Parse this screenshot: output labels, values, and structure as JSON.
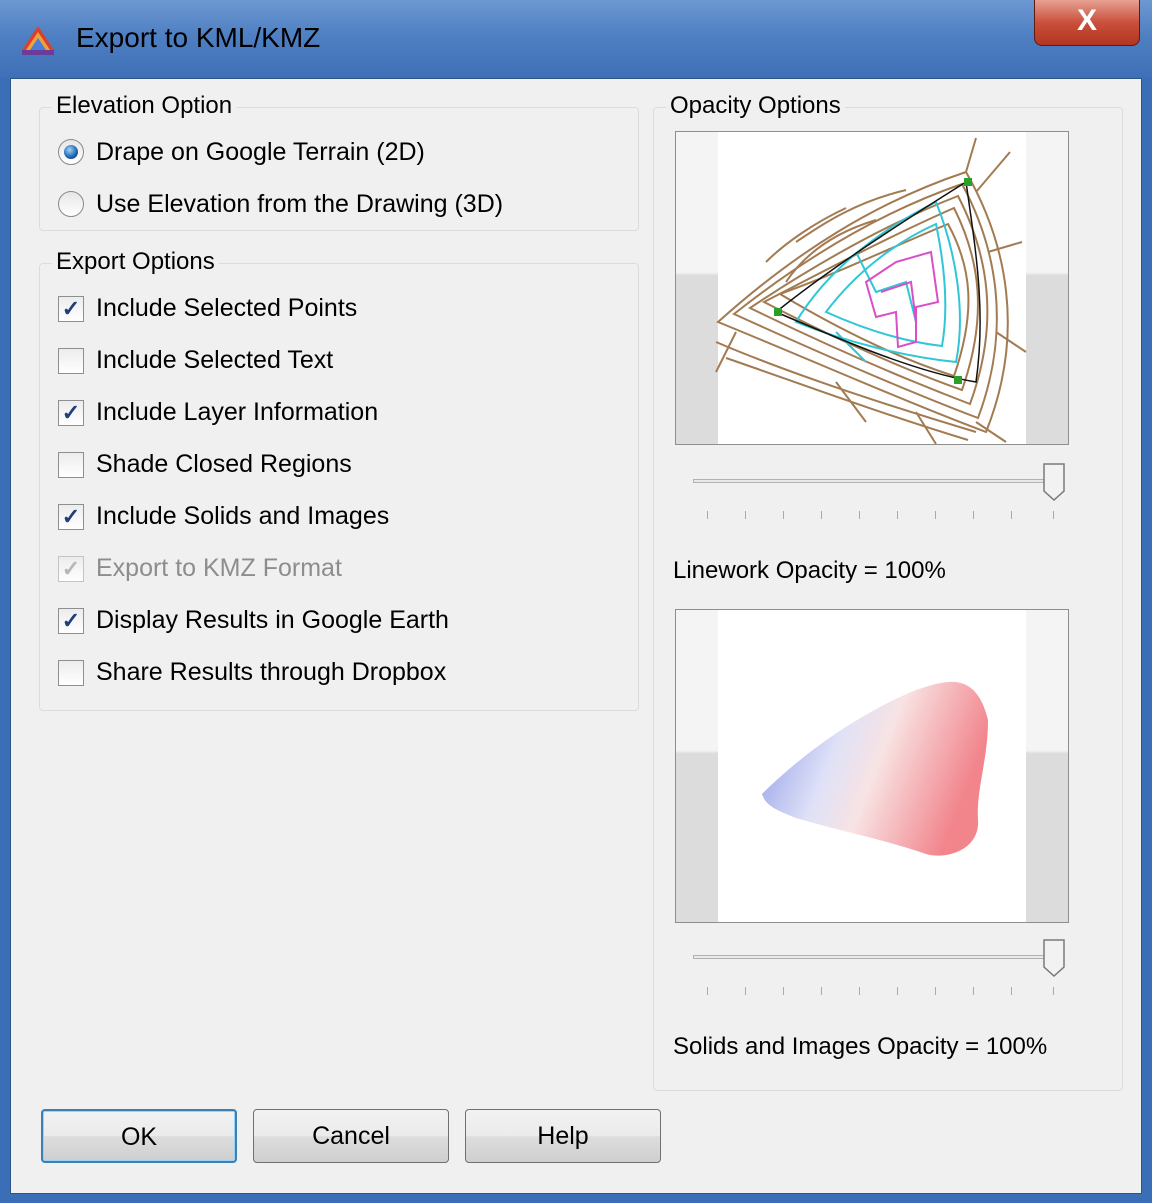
{
  "window": {
    "title": "Export to KML/KMZ",
    "close_label": "X"
  },
  "elevation": {
    "group_label": "Elevation Option",
    "options": [
      {
        "label": "Drape on Google Terrain (2D)",
        "selected": true
      },
      {
        "label": "Use Elevation from the Drawing (3D)",
        "selected": false
      }
    ]
  },
  "export": {
    "group_label": "Export Options",
    "options": [
      {
        "label": "Include Selected Points",
        "checked": true,
        "enabled": true
      },
      {
        "label": "Include Selected Text",
        "checked": false,
        "enabled": true
      },
      {
        "label": "Include Layer Information",
        "checked": true,
        "enabled": true
      },
      {
        "label": "Shade Closed Regions",
        "checked": false,
        "enabled": true
      },
      {
        "label": "Include Solids and Images",
        "checked": true,
        "enabled": true
      },
      {
        "label": "Export to KMZ Format",
        "checked": true,
        "enabled": false
      },
      {
        "label": "Display Results in Google Earth",
        "checked": true,
        "enabled": true
      },
      {
        "label": "Share Results through Dropbox",
        "checked": false,
        "enabled": true
      }
    ]
  },
  "opacity": {
    "group_label": "Opacity Options",
    "linework": {
      "caption": "Linework Opacity = 100%",
      "value": 100
    },
    "solids": {
      "caption": "Solids and Images Opacity = 100%",
      "value": 100
    }
  },
  "buttons": {
    "ok": "OK",
    "cancel": "Cancel",
    "help": "Help"
  },
  "colors": {
    "titlebar": "#4f80c3",
    "close": "#c9503c",
    "contour": "#a37b52",
    "cyan": "#2fc6d6",
    "magenta": "#d94fc8"
  }
}
